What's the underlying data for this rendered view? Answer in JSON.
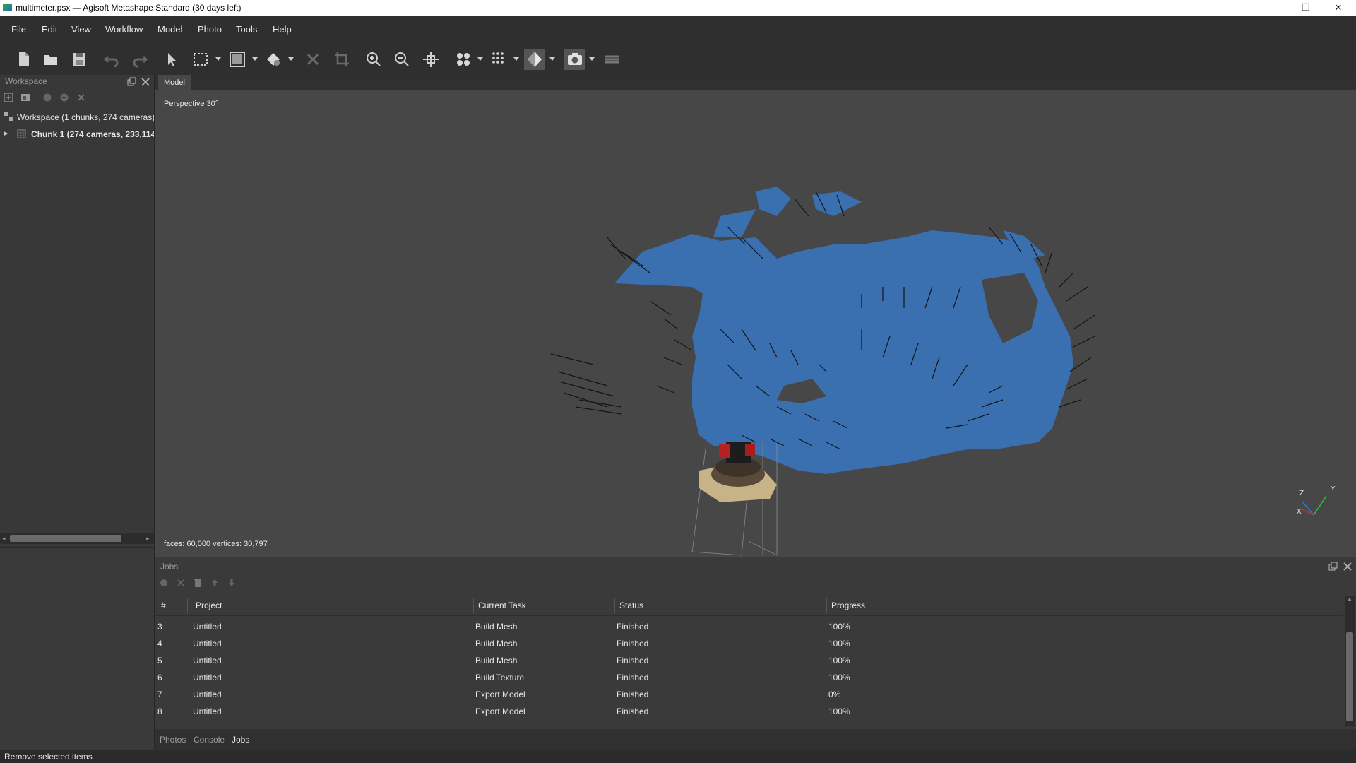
{
  "window": {
    "title": "multimeter.psx — Agisoft Metashape Standard (30 days left)",
    "minimize": "—",
    "restore": "❐",
    "close": "✕"
  },
  "menu": [
    "File",
    "Edit",
    "View",
    "Workflow",
    "Model",
    "Photo",
    "Tools",
    "Help"
  ],
  "workspace": {
    "title": "Workspace",
    "root_label": "Workspace (1 chunks, 274 cameras)",
    "chunk_label": "Chunk 1 (274 cameras, 233,114",
    "expand_glyph": "▸"
  },
  "viewport": {
    "tab": "Model",
    "projection": "Perspective 30°",
    "stats": "faces: 60,000 vertices: 30,797",
    "axes": {
      "x": "X",
      "y": "Y",
      "z": "Z"
    }
  },
  "jobs": {
    "title": "Jobs",
    "columns": [
      "#",
      "Project",
      "Current Task",
      "Status",
      "Progress"
    ],
    "rows": [
      {
        "num": "3",
        "project": "Untitled",
        "task": "Build Mesh",
        "status": "Finished",
        "progress": "100%"
      },
      {
        "num": "4",
        "project": "Untitled",
        "task": "Build Mesh",
        "status": "Finished",
        "progress": "100%"
      },
      {
        "num": "5",
        "project": "Untitled",
        "task": "Build Mesh",
        "status": "Finished",
        "progress": "100%"
      },
      {
        "num": "6",
        "project": "Untitled",
        "task": "Build Texture",
        "status": "Finished",
        "progress": "100%"
      },
      {
        "num": "7",
        "project": "Untitled",
        "task": "Export Model",
        "status": "Finished",
        "progress": "0%"
      },
      {
        "num": "8",
        "project": "Untitled",
        "task": "Export Model",
        "status": "Finished",
        "progress": "100%"
      }
    ]
  },
  "bottom_tabs": [
    "Photos",
    "Console",
    "Jobs"
  ],
  "status_bar": "Remove selected items",
  "colors": {
    "camera_blue": "#3a6fb0",
    "accent": "#ffffff"
  }
}
